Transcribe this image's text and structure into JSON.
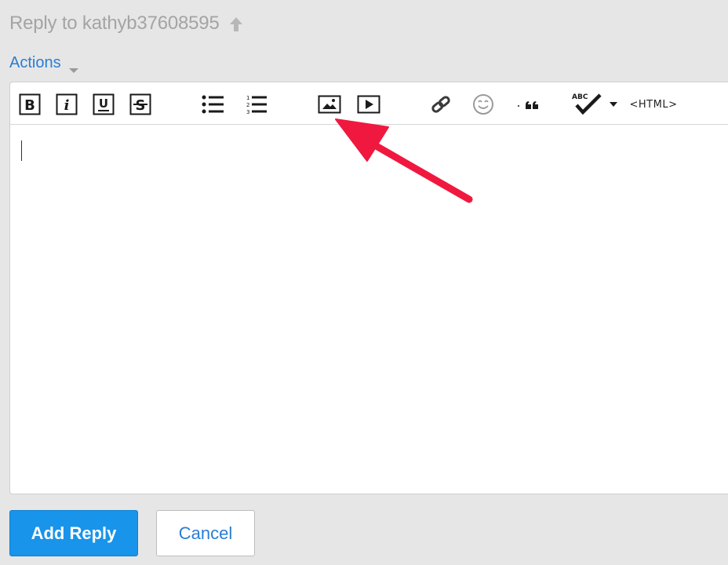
{
  "header": {
    "title": "Reply to kathyb37608595",
    "up_icon": "arrow-up-icon"
  },
  "actions": {
    "label": "Actions",
    "icon": "caret-down-icon"
  },
  "toolbar": {
    "items": [
      {
        "name": "bold",
        "icon": "bold-icon",
        "glyph": "B"
      },
      {
        "name": "italic",
        "icon": "italic-icon",
        "glyph": "i"
      },
      {
        "name": "underline",
        "icon": "underline-icon",
        "glyph": "U"
      },
      {
        "name": "strikethrough",
        "icon": "strikethrough-icon",
        "glyph": "S"
      },
      {
        "name": "bulleted-list",
        "icon": "bulleted-list-icon"
      },
      {
        "name": "numbered-list",
        "icon": "numbered-list-icon"
      },
      {
        "name": "insert-image",
        "icon": "image-icon"
      },
      {
        "name": "insert-video",
        "icon": "video-icon"
      },
      {
        "name": "insert-link",
        "icon": "link-icon"
      },
      {
        "name": "emoji",
        "icon": "emoji-icon"
      },
      {
        "name": "quote",
        "icon": "quote-icon"
      },
      {
        "name": "spellcheck",
        "icon": "spellcheck-icon",
        "label": "ABC"
      },
      {
        "name": "spellcheck-menu",
        "icon": "dropdown-arrow-icon"
      },
      {
        "name": "html-source",
        "label": "<HTML>"
      }
    ]
  },
  "editor": {
    "content": ""
  },
  "buttons": {
    "add_reply": "Add Reply",
    "cancel": "Cancel"
  },
  "annotation": {
    "arrow_color": "#f0183f",
    "points_to": "insert-image"
  },
  "colors": {
    "background": "#e6e6e6",
    "link": "#2a7dd4",
    "primary_button": "#1894ea",
    "title_gray": "#a4a4a4"
  }
}
